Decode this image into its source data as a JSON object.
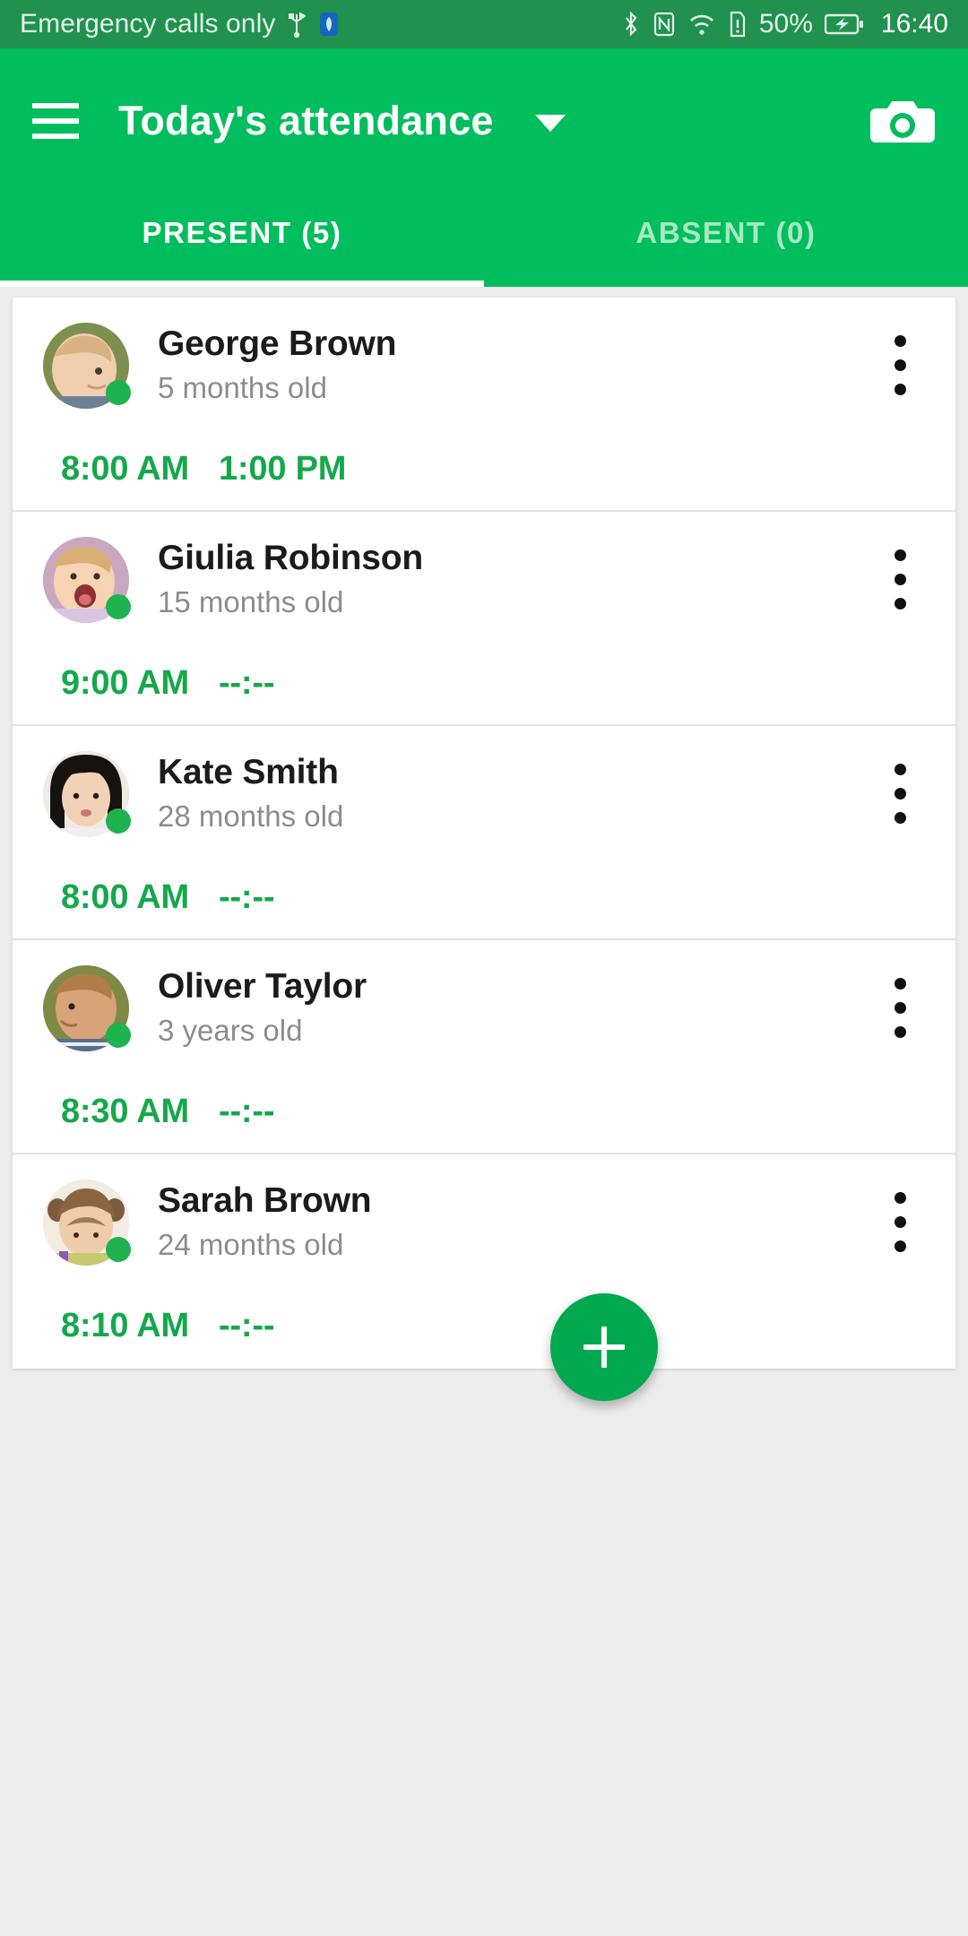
{
  "status_bar": {
    "carrier_text": "Emergency calls only",
    "icons": [
      "usb-icon",
      "shield-icon",
      "bluetooth-icon",
      "nfc-icon",
      "wifi-icon",
      "sim-alert-icon",
      "battery-charging-icon"
    ],
    "battery_percent": "50%",
    "clock": "16:40",
    "background_color": "#219150"
  },
  "app_bar": {
    "menu_icon": "hamburger-menu-icon",
    "title": "Today's attendance",
    "dropdown_icon": "chevron-down-icon",
    "camera_icon": "camera-icon",
    "background_color": "#00bd5d"
  },
  "tabs": {
    "items": [
      {
        "label": "PRESENT (5)",
        "active": true
      },
      {
        "label": "ABSENT (0)",
        "active": false
      }
    ],
    "active_color": "#ffffff",
    "inactive_color": "#a8e9c4",
    "indicator_color": "#ffffff"
  },
  "list": {
    "children": [
      {
        "name": "George Brown",
        "age": "5 months old",
        "check_in": "8:00 AM",
        "check_out": "1:00 PM",
        "present": true,
        "avatar": "photo-baby-boy-blond"
      },
      {
        "name": "Giulia Robinson",
        "age": "15 months old",
        "check_in": "9:00 AM",
        "check_out": "--:--",
        "present": true,
        "avatar": "photo-toddler-girl-laughing"
      },
      {
        "name": "Kate Smith",
        "age": "28 months old",
        "check_in": "8:00 AM",
        "check_out": "--:--",
        "present": true,
        "avatar": "photo-girl-dark-hair"
      },
      {
        "name": "Oliver Taylor",
        "age": "3 years old",
        "check_in": "8:30 AM",
        "check_out": "--:--",
        "present": true,
        "avatar": "photo-boy-profile"
      },
      {
        "name": "Sarah Brown",
        "age": "24 months old",
        "check_in": "8:10 AM",
        "check_out": "--:--",
        "present": true,
        "avatar": "photo-girl-pigtails"
      }
    ],
    "time_color": "#15a84b",
    "name_color": "#1b1b1b",
    "age_color": "#8c8c8c",
    "presence_dot_color": "#1eb34f",
    "kebab_icon": "more-vertical-icon"
  },
  "fab": {
    "icon": "plus-icon",
    "color": "#00a84f"
  }
}
